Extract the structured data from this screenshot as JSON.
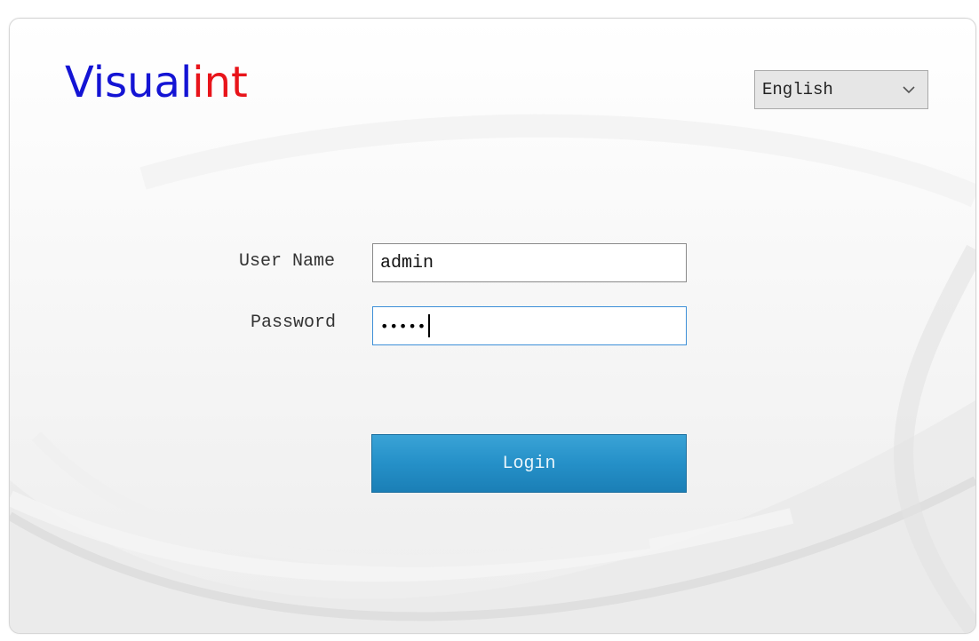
{
  "logo": {
    "part_a": "Visual",
    "part_b": "int"
  },
  "language": {
    "selected": "English",
    "icon": "chevron-down-icon"
  },
  "form": {
    "username_label": "User Name",
    "username_value": "admin",
    "password_label": "Password",
    "password_mask": "•••••",
    "login_label": "Login"
  },
  "colors": {
    "logo_blue": "#1414d4",
    "logo_red": "#e8141a",
    "button_blue": "#2590c8",
    "focus_border": "#3d8fd8"
  }
}
